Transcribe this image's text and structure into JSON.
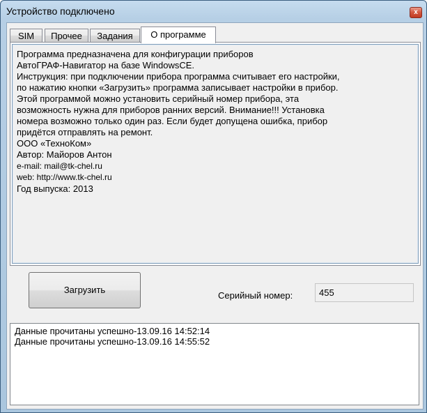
{
  "window": {
    "title": "Устройство подключено",
    "close_glyph": "x"
  },
  "tabs": [
    {
      "label": "SIM",
      "active": false
    },
    {
      "label": "Прочее",
      "active": false
    },
    {
      "label": "Задания",
      "active": false
    },
    {
      "label": "О программе",
      "active": true
    }
  ],
  "about": {
    "lines": [
      "Программа предназначена для конфигурации приборов",
      "АвтоГРАФ-Навигатор на базе WindowsCE.",
      "Инструкция: при подключении прибора программа считывает его настройки,",
      "по нажатию кнопки «Загрузить» программа записывает настройки в прибор.",
      "Этой программой можно установить серийный номер прибора, эта",
      "возможность нужна для приборов ранних версий. Внимание!!! Установка",
      "номера возможно только один раз. Если будет допущена ошибка, прибор",
      "придётся отправлять на ремонт.",
      "ООО «ТехноКом»",
      "Автор: Майоров Антон",
      "e-mail: mail@tk-chel.ru",
      "web: http://www.tk-chel.ru",
      "Год выпуска: 2013"
    ]
  },
  "actions": {
    "load_label": "Загрузить"
  },
  "serial": {
    "label": "Серийный номер:",
    "value": "455"
  },
  "log": {
    "lines": [
      "Данные прочитаны успешно-13.09.16 14:52:14",
      "Данные прочитаны успешно-13.09.16 14:55:52"
    ]
  }
}
